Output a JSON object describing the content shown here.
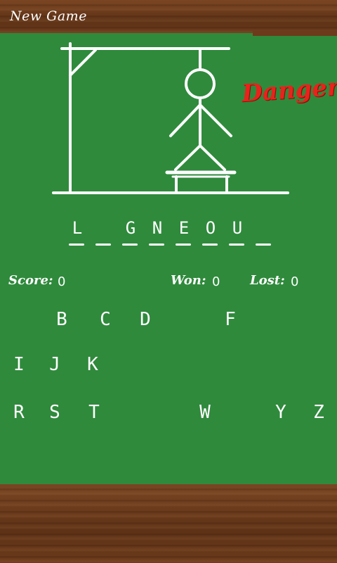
{
  "header": {
    "title": "New Game"
  },
  "status": {
    "danger_text": "Danger!"
  },
  "word": {
    "letters": [
      "L",
      "",
      "G",
      "N",
      "E",
      "O",
      "U",
      ""
    ]
  },
  "stats": {
    "score_label": "Score:",
    "score_value": "0",
    "won_label": "Won:",
    "won_value": "0",
    "lost_label": "Lost:",
    "lost_value": "0"
  },
  "keyboard": {
    "row1": [
      "B",
      "C",
      "D",
      "F"
    ],
    "row2": [
      "I",
      "J",
      "K"
    ],
    "row3": [
      "R",
      "S",
      "T",
      "W",
      "Y",
      "Z"
    ]
  },
  "colors": {
    "board": "#2f8a3c",
    "wood": "#6b3a1c",
    "danger": "#e8231c",
    "chalk": "#ffffff"
  }
}
